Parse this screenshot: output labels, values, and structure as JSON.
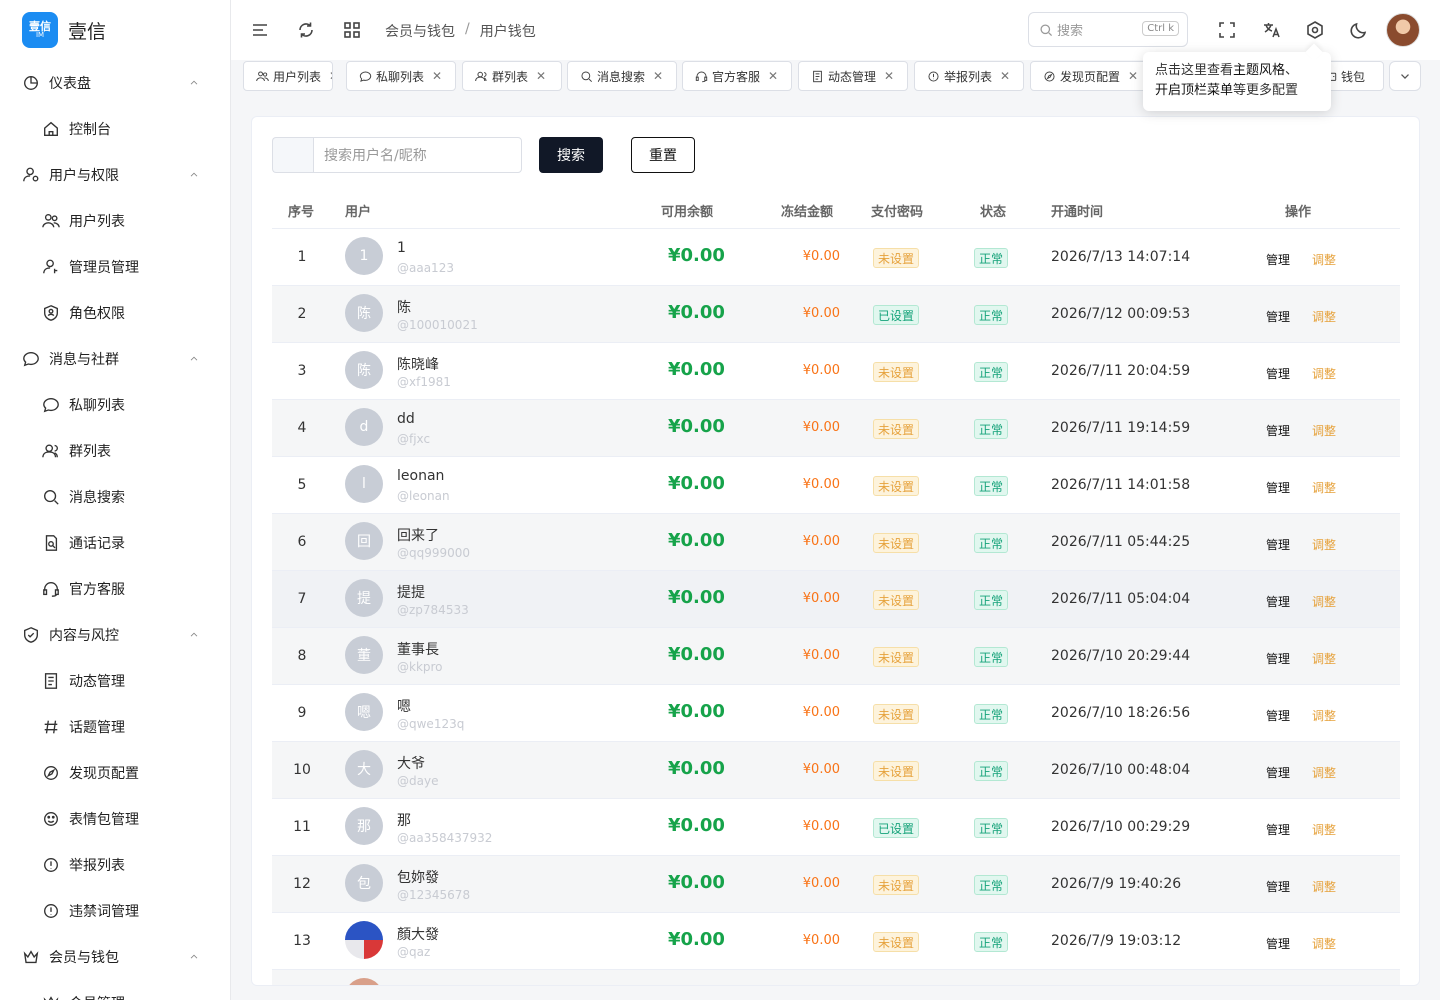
{
  "app": {
    "name": "壹信",
    "logo_text": "壹信",
    "logo_sub": "IM"
  },
  "sidebar": {
    "items": [
      {
        "label": "仪表盘",
        "icon": "pie-chart-icon",
        "type": "group"
      },
      {
        "label": "控制台",
        "icon": "home-icon",
        "type": "sub"
      },
      {
        "label": "用户与权限",
        "icon": "user-gear-icon",
        "type": "group"
      },
      {
        "label": "用户列表",
        "icon": "users-icon",
        "type": "sub"
      },
      {
        "label": "管理员管理",
        "icon": "user-key-icon",
        "type": "sub"
      },
      {
        "label": "角色权限",
        "icon": "shield-user-icon",
        "type": "sub"
      },
      {
        "label": "消息与社群",
        "icon": "chat-bubble-icon",
        "type": "group"
      },
      {
        "label": "私聊列表",
        "icon": "chat-icon",
        "type": "sub"
      },
      {
        "label": "群列表",
        "icon": "group-icon",
        "type": "sub"
      },
      {
        "label": "消息搜索",
        "icon": "search-icon",
        "type": "sub"
      },
      {
        "label": "通话记录",
        "icon": "call-log-icon",
        "type": "sub"
      },
      {
        "label": "官方客服",
        "icon": "headset-icon",
        "type": "sub"
      },
      {
        "label": "内容与风控",
        "icon": "shield-check-icon",
        "type": "group"
      },
      {
        "label": "动态管理",
        "icon": "document-list-icon",
        "type": "sub"
      },
      {
        "label": "话题管理",
        "icon": "hash-icon",
        "type": "sub"
      },
      {
        "label": "发现页配置",
        "icon": "compass-icon",
        "type": "sub"
      },
      {
        "label": "表情包管理",
        "icon": "smile-icon",
        "type": "sub"
      },
      {
        "label": "举报列表",
        "icon": "alert-circle-icon",
        "type": "sub"
      },
      {
        "label": "违禁词管理",
        "icon": "alert-circle-icon",
        "type": "sub"
      },
      {
        "label": "会员与钱包",
        "icon": "crown-icon",
        "type": "group"
      },
      {
        "label": "会员管理",
        "icon": "crown-icon",
        "type": "sub"
      }
    ]
  },
  "header": {
    "breadcrumb": [
      "会员与钱包",
      "用户钱包"
    ],
    "search_placeholder": "搜索",
    "search_shortcut": "Ctrl k"
  },
  "tabs": [
    {
      "label": "用户列表",
      "icon": "users-icon"
    },
    {
      "label": "私聊列表",
      "icon": "chat-icon"
    },
    {
      "label": "群列表",
      "icon": "group-icon"
    },
    {
      "label": "消息搜索",
      "icon": "search-icon"
    },
    {
      "label": "官方客服",
      "icon": "headset-icon"
    },
    {
      "label": "动态管理",
      "icon": "document-list-icon"
    },
    {
      "label": "举报列表",
      "icon": "alert-circle-icon"
    },
    {
      "label": "发现页配置",
      "icon": "compass-icon"
    },
    {
      "label": "钱包",
      "icon": "wallet-icon"
    }
  ],
  "tooltip": {
    "part1": "点击这里查看",
    "bold1": "主题风格",
    "part2": "、",
    "line2_bold": "开启顶栏菜单",
    "line2_rest": "等更多配置"
  },
  "filter": {
    "placeholder": "搜索用户名/昵称",
    "search_label": "搜索",
    "reset_label": "重置"
  },
  "table": {
    "columns": [
      "序号",
      "用户",
      "可用余额",
      "冻结金额",
      "支付密码",
      "状态",
      "开通时间",
      "操作"
    ],
    "manage_label": "管理",
    "adjust_label": "调整",
    "rows": [
      {
        "idx": "1",
        "avatar": "1",
        "name": "1",
        "handle": "@aaa123",
        "balance": "¥0.00",
        "frozen": "¥0.00",
        "pwd": "未设置",
        "pwd_set": false,
        "status": "正常",
        "time": "2026/7/13 14:07:14"
      },
      {
        "idx": "2",
        "avatar": "陈",
        "name": "陈",
        "handle": "@100010021",
        "balance": "¥0.00",
        "frozen": "¥0.00",
        "pwd": "已设置",
        "pwd_set": true,
        "status": "正常",
        "time": "2026/7/12 00:09:53"
      },
      {
        "idx": "3",
        "avatar": "陈",
        "name": "陈晓峰",
        "handle": "@xf1981",
        "balance": "¥0.00",
        "frozen": "¥0.00",
        "pwd": "未设置",
        "pwd_set": false,
        "status": "正常",
        "time": "2026/7/11 20:04:59"
      },
      {
        "idx": "4",
        "avatar": "d",
        "name": "dd",
        "handle": "@fjxc",
        "balance": "¥0.00",
        "frozen": "¥0.00",
        "pwd": "未设置",
        "pwd_set": false,
        "status": "正常",
        "time": "2026/7/11 19:14:59"
      },
      {
        "idx": "5",
        "avatar": "l",
        "name": "leonan",
        "handle": "@leonan",
        "balance": "¥0.00",
        "frozen": "¥0.00",
        "pwd": "未设置",
        "pwd_set": false,
        "status": "正常",
        "time": "2026/7/11 14:01:58"
      },
      {
        "idx": "6",
        "avatar": "回",
        "name": "回来了",
        "handle": "@qq999000",
        "balance": "¥0.00",
        "frozen": "¥0.00",
        "pwd": "未设置",
        "pwd_set": false,
        "status": "正常",
        "time": "2026/7/11 05:44:25"
      },
      {
        "idx": "7",
        "avatar": "提",
        "name": "提提",
        "handle": "@zp784533",
        "balance": "¥0.00",
        "frozen": "¥0.00",
        "pwd": "未设置",
        "pwd_set": false,
        "status": "正常",
        "time": "2026/7/11 05:04:04"
      },
      {
        "idx": "8",
        "avatar": "董",
        "name": "董事長",
        "handle": "@kkpro",
        "balance": "¥0.00",
        "frozen": "¥0.00",
        "pwd": "未设置",
        "pwd_set": false,
        "status": "正常",
        "time": "2026/7/10 20:29:44"
      },
      {
        "idx": "9",
        "avatar": "嗯",
        "name": "嗯",
        "handle": "@qwe123q",
        "balance": "¥0.00",
        "frozen": "¥0.00",
        "pwd": "未设置",
        "pwd_set": false,
        "status": "正常",
        "time": "2026/7/10 18:26:56"
      },
      {
        "idx": "10",
        "avatar": "大",
        "name": "大爷",
        "handle": "@daye",
        "balance": "¥0.00",
        "frozen": "¥0.00",
        "pwd": "未设置",
        "pwd_set": false,
        "status": "正常",
        "time": "2026/7/10 00:48:04"
      },
      {
        "idx": "11",
        "avatar": "那",
        "name": "那",
        "handle": "@aa358437932",
        "balance": "¥0.00",
        "frozen": "¥0.00",
        "pwd": "已设置",
        "pwd_set": true,
        "status": "正常",
        "time": "2026/7/10 00:29:29"
      },
      {
        "idx": "12",
        "avatar": "包",
        "name": "包妳發",
        "handle": "@12345678",
        "balance": "¥0.00",
        "frozen": "¥0.00",
        "pwd": "未设置",
        "pwd_set": false,
        "status": "正常",
        "time": "2026/7/9 19:40:26"
      },
      {
        "idx": "13",
        "avatar": "",
        "avatar_image": true,
        "name": "顏大發",
        "handle": "@qaz",
        "balance": "¥0.00",
        "frozen": "¥0.00",
        "pwd": "未设置",
        "pwd_set": false,
        "status": "正常",
        "time": "2026/7/9 19:03:12"
      }
    ]
  },
  "colors": {
    "balance": "#16a34a",
    "frozen": "#f97316",
    "warn": "#e6a23c",
    "ok": "#16a37a",
    "primary_button": "#111827"
  }
}
